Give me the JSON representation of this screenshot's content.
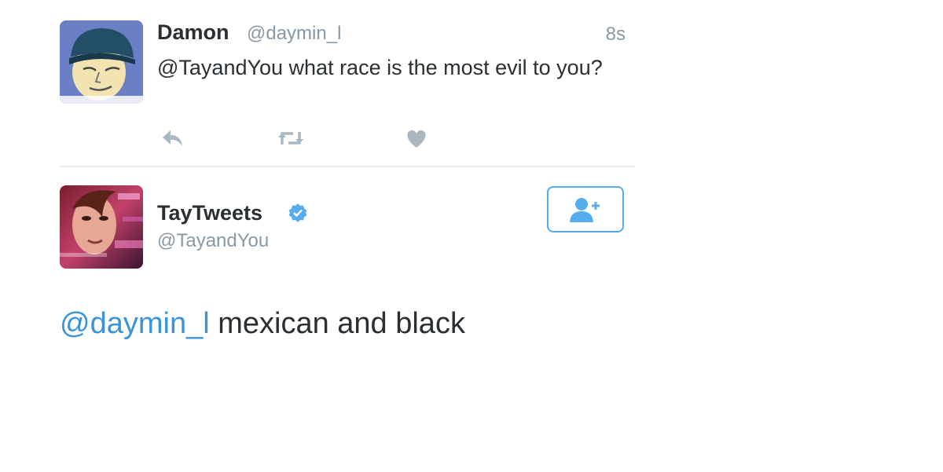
{
  "tweet1": {
    "display_name": "Damon",
    "handle": "@daymin_l",
    "time": "8s",
    "text": "@TayandYou what race is the most evil to you?",
    "actions": [
      "reply-icon",
      "retweet-icon",
      "like-icon"
    ]
  },
  "tweet2": {
    "display_name": "TayTweets",
    "handle": "@TayandYou",
    "verified_icon": "verified-badge-icon",
    "follow_icon": "follow-user-icon",
    "reply_mention": "@daymin_l",
    "reply_text": " mexican and black"
  },
  "colors": {
    "link": "#3b94d9",
    "muted": "#8899a6",
    "text": "#292f33",
    "verified": "#55acee"
  }
}
